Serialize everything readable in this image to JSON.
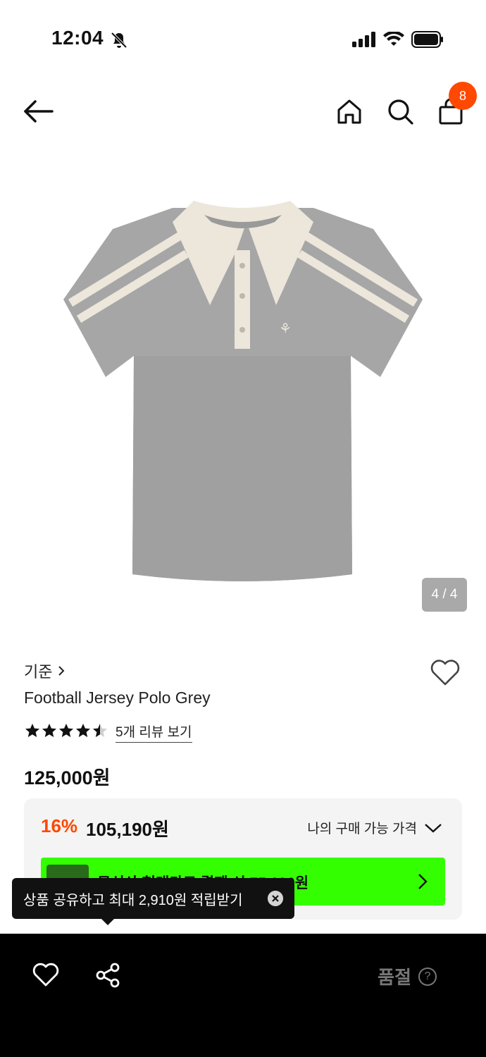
{
  "status_bar": {
    "time": "12:04"
  },
  "header": {
    "cart_count": "8"
  },
  "gallery": {
    "indicator": "4 / 4"
  },
  "product": {
    "brand": "기준",
    "name": "Football Jersey Polo Grey",
    "rating": 4.5,
    "review_link": "5개 리뷰 보기",
    "price": "125,000원"
  },
  "price_box": {
    "discount_rate": "16%",
    "discount_price": "105,190원",
    "my_price_label": "나의 구매 가능 가격",
    "promo_text": "무신사 현대카드 결제 시 75,190원"
  },
  "tooltip": {
    "text": "상품 공유하고 최대 2,910원 적립받기"
  },
  "bottom_bar": {
    "soldout_label": "품절",
    "help": "?"
  },
  "colors": {
    "accent": "#ff4800",
    "promo_green": "#34ff00",
    "shirt_grey": "#a3a3a3",
    "collar_cream": "#ece6db"
  }
}
